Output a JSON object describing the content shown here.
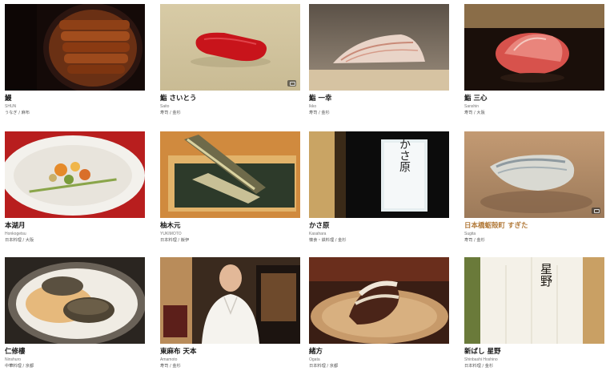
{
  "restaurants": [
    {
      "name": "鰻",
      "roman": "SHUN",
      "category": "うなぎ / 麻布"
    },
    {
      "name": "鮨 さいとう",
      "roman": "Saito",
      "category": "寿司 / 金杉"
    },
    {
      "name": "鮨 一幸",
      "roman": "Ikko",
      "category": "寿司 / 金杉"
    },
    {
      "name": "鮨 三心",
      "roman": "Sanshin",
      "category": "寿司 / 大阪"
    },
    {
      "name": "本湖月",
      "roman": "Honkogetsu",
      "category": "日本料理 / 大阪"
    },
    {
      "name": "柚木元",
      "roman": "YUKIMOTO",
      "category": "日本料理 / 飯伊"
    },
    {
      "name": "かさ原",
      "roman": "Kasahara",
      "category": "懐食・鉄料理 / 金杉"
    },
    {
      "name": "日本橋蛎殻町 すぎた",
      "roman": "Sugita",
      "category": "寿司 / 金杉"
    },
    {
      "name": "仁修樓",
      "roman": "Ninshuro",
      "category": "中華料理 / 京都"
    },
    {
      "name": "東麻布 天本",
      "roman": "Amamoto",
      "category": "寿司 / 金杉"
    },
    {
      "name": "緒方",
      "roman": "Ogata",
      "category": "日本料理 / 京都"
    },
    {
      "name": "新ばし 星野",
      "roman": "Shinbashi Hoshino",
      "category": "日本料理 / 金杉"
    }
  ],
  "noren_text": "星野",
  "sign_text": "かさ原",
  "colors": {
    "highlight": "#b27a3a"
  }
}
